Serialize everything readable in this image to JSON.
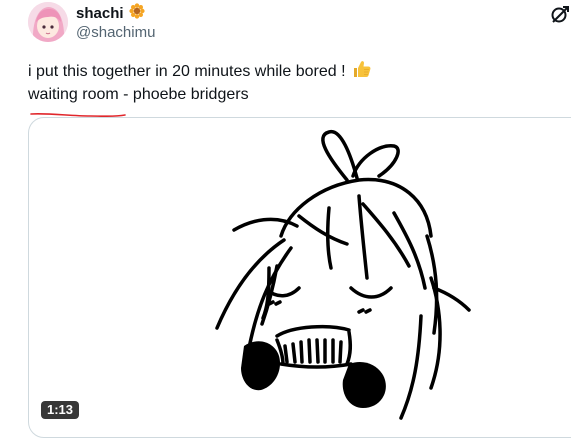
{
  "tweet": {
    "display_name": "shachi",
    "handle": "@shachimu",
    "text_line_1": "i put this together in 20 minutes while bored !",
    "text_line_2": "waiting room - phoebe bridgers",
    "line1_emoji": "thumbs-up-emoji",
    "badge_icon": "sunflower-badge-icon",
    "grok_icon": "grok-icon"
  },
  "media": {
    "type": "video",
    "duration": "1:13"
  },
  "colors": {
    "text": "#0f1419",
    "secondary": "#536471",
    "border": "#cfd9de",
    "underline": "#e0262b",
    "badge": "#f5a524",
    "thumbs": "#f7c23b"
  }
}
